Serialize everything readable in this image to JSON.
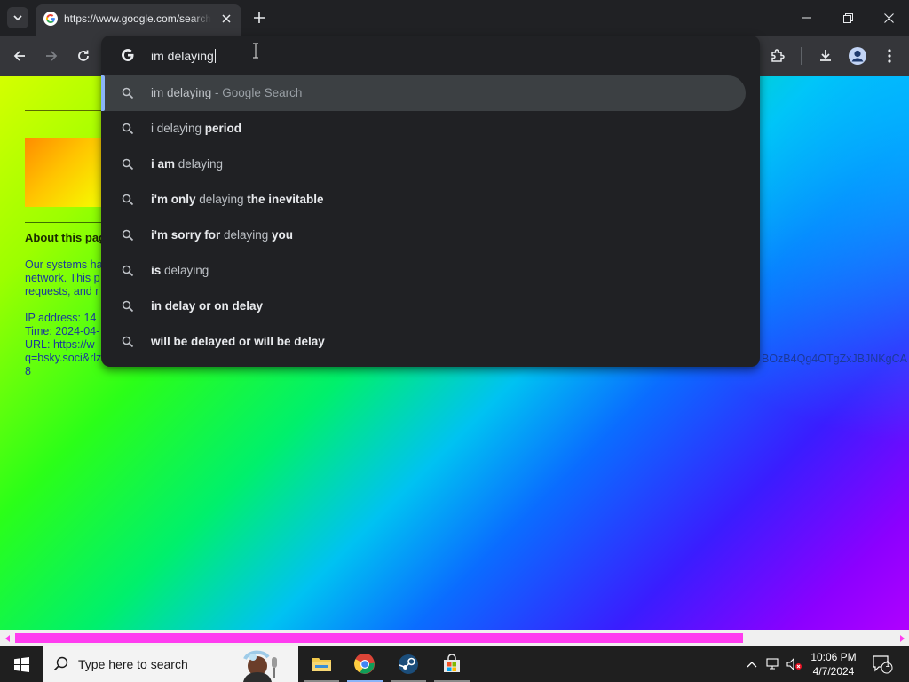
{
  "tab": {
    "title": "https://www.google.com/search?q=im+delaying"
  },
  "omnibox": {
    "value": "im delaying",
    "suggestions": [
      {
        "parts": [
          {
            "t": "im delaying",
            "b": false
          }
        ],
        "suffix": " - Google Search",
        "selected": true
      },
      {
        "parts": [
          {
            "t": "i delaying ",
            "b": false
          },
          {
            "t": "period",
            "b": true
          }
        ],
        "suffix": "",
        "selected": false
      },
      {
        "parts": [
          {
            "t": "i am",
            "b": true
          },
          {
            "t": " delaying",
            "b": false
          }
        ],
        "suffix": "",
        "selected": false
      },
      {
        "parts": [
          {
            "t": "i'm only",
            "b": true
          },
          {
            "t": " delaying ",
            "b": false
          },
          {
            "t": "the inevitable",
            "b": true
          }
        ],
        "suffix": "",
        "selected": false
      },
      {
        "parts": [
          {
            "t": "i'm sorry for",
            "b": true
          },
          {
            "t": " delaying ",
            "b": false
          },
          {
            "t": "you",
            "b": true
          }
        ],
        "suffix": "",
        "selected": false
      },
      {
        "parts": [
          {
            "t": "is",
            "b": true
          },
          {
            "t": " delaying",
            "b": false
          }
        ],
        "suffix": "",
        "selected": false
      },
      {
        "parts": [
          {
            "t": "in delay or on delay",
            "b": true
          }
        ],
        "suffix": "",
        "selected": false
      },
      {
        "parts": [
          {
            "t": "will be delayed or will be delay",
            "b": true
          }
        ],
        "suffix": "",
        "selected": false
      }
    ]
  },
  "page": {
    "heading": "About this pag",
    "para_lines": [
      "Our systems ha",
      "network. This p",
      "requests, and r"
    ],
    "ip_lines": [
      "IP address: 14",
      "Time: 2024-04-",
      "URL: https://w",
      "q=bsky.soci&rlz",
      "8"
    ],
    "url_tail": "BOzB4Qg4OTgZxJBJNKgCA"
  },
  "taskbar": {
    "search_placeholder": "Type here to search",
    "time": "10:06 PM",
    "date": "4/7/2024",
    "notification_count": "1"
  },
  "colors": {
    "accent": "#8ab4f8",
    "scroll_thumb": "#ff3cf0"
  },
  "icons": [
    "tab-search-icon",
    "google-favicon-icon",
    "close-icon",
    "plus-icon",
    "minimize-icon",
    "restore-icon",
    "back-icon",
    "forward-icon",
    "reload-icon",
    "google-g-icon",
    "search-icon",
    "extensions-icon",
    "download-icon",
    "profile-icon",
    "menu-icon",
    "windows-start-icon",
    "file-explorer-icon",
    "chrome-icon",
    "steam-icon",
    "microsoft-store-icon",
    "chevron-up-icon",
    "network-icon",
    "volume-muted-icon",
    "notification-icon"
  ]
}
